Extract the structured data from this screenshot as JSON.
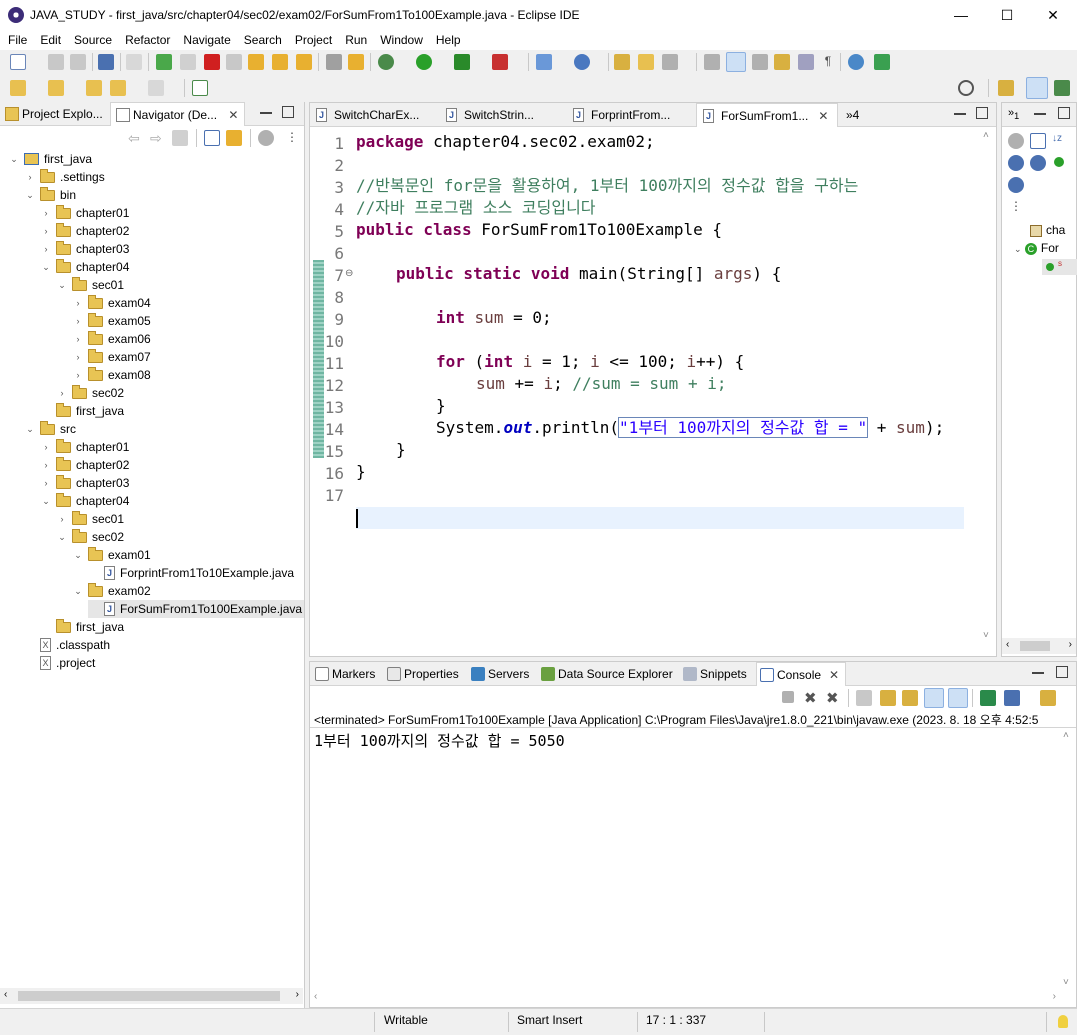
{
  "window": {
    "title": "JAVA_STUDY - first_java/src/chapter04/sec02/exam02/ForSumFrom1To100Example.java - Eclipse IDE",
    "minimize": "—",
    "maximize": "☐",
    "close": "✕"
  },
  "menu": [
    "File",
    "Edit",
    "Source",
    "Refactor",
    "Navigate",
    "Search",
    "Project",
    "Run",
    "Window",
    "Help"
  ],
  "left_panel": {
    "tabs": [
      {
        "label": "Project Explo...",
        "active": false
      },
      {
        "label": "Navigator (De...",
        "active": true
      }
    ],
    "tree": [
      {
        "label": "first_java",
        "depth": 0,
        "type": "project",
        "expanded": true
      },
      {
        "label": ".settings",
        "depth": 1,
        "type": "folder",
        "expanded": false
      },
      {
        "label": "bin",
        "depth": 1,
        "type": "folder",
        "expanded": true
      },
      {
        "label": "chapter01",
        "depth": 2,
        "type": "folder",
        "expanded": false
      },
      {
        "label": "chapter02",
        "depth": 2,
        "type": "folder",
        "expanded": false
      },
      {
        "label": "chapter03",
        "depth": 2,
        "type": "folder",
        "expanded": false
      },
      {
        "label": "chapter04",
        "depth": 2,
        "type": "folder",
        "expanded": true
      },
      {
        "label": "sec01",
        "depth": 3,
        "type": "folder",
        "expanded": true
      },
      {
        "label": "exam04",
        "depth": 4,
        "type": "folder",
        "expanded": false
      },
      {
        "label": "exam05",
        "depth": 4,
        "type": "folder",
        "expanded": false
      },
      {
        "label": "exam06",
        "depth": 4,
        "type": "folder",
        "expanded": false
      },
      {
        "label": "exam07",
        "depth": 4,
        "type": "folder",
        "expanded": false
      },
      {
        "label": "exam08",
        "depth": 4,
        "type": "folder",
        "expanded": false
      },
      {
        "label": "sec02",
        "depth": 3,
        "type": "folder",
        "expanded": false
      },
      {
        "label": "first_java",
        "depth": 2,
        "type": "folder",
        "leaf": true
      },
      {
        "label": "src",
        "depth": 1,
        "type": "folder",
        "expanded": true
      },
      {
        "label": "chapter01",
        "depth": 2,
        "type": "folder",
        "expanded": false
      },
      {
        "label": "chapter02",
        "depth": 2,
        "type": "folder",
        "expanded": false
      },
      {
        "label": "chapter03",
        "depth": 2,
        "type": "folder",
        "expanded": false
      },
      {
        "label": "chapter04",
        "depth": 2,
        "type": "folder",
        "expanded": true
      },
      {
        "label": "sec01",
        "depth": 3,
        "type": "folder",
        "expanded": false
      },
      {
        "label": "sec02",
        "depth": 3,
        "type": "folder",
        "expanded": true
      },
      {
        "label": "exam01",
        "depth": 4,
        "type": "folder",
        "expanded": true
      },
      {
        "label": "ForprintFrom1To10Example.java",
        "depth": 5,
        "type": "java",
        "leaf": true
      },
      {
        "label": "exam02",
        "depth": 4,
        "type": "folder",
        "expanded": true
      },
      {
        "label": "ForSumFrom1To100Example.java",
        "depth": 5,
        "type": "java",
        "leaf": true,
        "selected": true
      },
      {
        "label": "first_java",
        "depth": 2,
        "type": "folder",
        "leaf": true
      },
      {
        "label": ".classpath",
        "depth": 1,
        "type": "xml",
        "leaf": true
      },
      {
        "label": ".project",
        "depth": 1,
        "type": "xml",
        "leaf": true
      }
    ]
  },
  "editor": {
    "tabs": [
      {
        "label": "SwitchCharEx...",
        "active": false
      },
      {
        "label": "SwitchStrin...",
        "active": false
      },
      {
        "label": "ForprintFrom...",
        "active": false
      },
      {
        "label": "ForSumFrom1...",
        "active": true
      }
    ],
    "overflow": "»4",
    "line_numbers": [
      "1",
      "2",
      "3",
      "4",
      "5",
      "6",
      "7",
      "8",
      "9",
      "10",
      "11",
      "12",
      "13",
      "14",
      "15",
      "16",
      "17"
    ],
    "code": {
      "l1_kw": "package",
      "l1_rest": " chapter04.sec02.exam02;",
      "l3": "//반복문인 for문을 활용하여, 1부터 100까지의 정수값 합을 구하는",
      "l4": "//자바 프로그램 소스 코딩입니다",
      "l5_kw": "public class",
      "l5_rest": " ForSumFrom1To100Example {",
      "l7_kw": "public static void",
      "l7_rest": " main(String[] ",
      "l7_var": "args",
      "l7_end": ") {",
      "l9_kw": "int",
      "l9_var": "sum",
      "l9_end": " = 0;",
      "l11_kw1": "for",
      "l11_p1": " (",
      "l11_kw2": "int",
      "l11_var1": "i",
      "l11_p2": " = 1; ",
      "l11_var2": "i",
      "l11_p3": " <= 100; ",
      "l11_var3": "i",
      "l11_end": "++) {",
      "l12_var1": "sum",
      "l12_mid": " += ",
      "l12_var2": "i",
      "l12_semi": "; ",
      "l12_cm": "//sum = sum + i;",
      "l13": "}",
      "l14_a": "System.",
      "l14_fld": "out",
      "l14_b": ".println(",
      "l14_str": "\"1부터 100까지의 정수값 합 = \"",
      "l14_c": " + ",
      "l14_var": "sum",
      "l14_end": ");",
      "l15": "}",
      "l16": "}"
    }
  },
  "console": {
    "tabs": [
      {
        "label": "Markers",
        "active": false
      },
      {
        "label": "Properties",
        "active": false
      },
      {
        "label": "Servers",
        "active": false
      },
      {
        "label": "Data Source Explorer",
        "active": false
      },
      {
        "label": "Snippets",
        "active": false
      },
      {
        "label": "Console",
        "active": true
      }
    ],
    "terminated": "<terminated> ForSumFrom1To100Example [Java Application] C:\\Program Files\\Java\\jre1.8.0_221\\bin\\javaw.exe  (2023. 8. 18 오후 4:52:5",
    "output": "1부터 100까지의 정수값 합 = 5050"
  },
  "outline": {
    "items": [
      "cha",
      "For",
      "s"
    ]
  },
  "statusbar": {
    "writable": "Writable",
    "insert_mode": "Smart Insert",
    "position": "17 : 1 : 337"
  },
  "colors": {
    "keyword": "#7f0055",
    "comment": "#3f7f5f",
    "string": "#2a00ff",
    "field": "#0000c0",
    "local_var": "#6a3e3e",
    "current_line": "#e8f2fe"
  }
}
